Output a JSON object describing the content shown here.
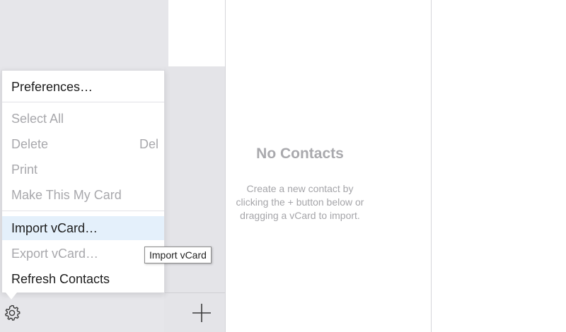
{
  "menu": {
    "items": [
      {
        "label": "Preferences…",
        "enabled": true
      },
      {
        "label": "Select All",
        "enabled": false
      },
      {
        "label": "Delete",
        "shortcut": "Del",
        "enabled": false
      },
      {
        "label": "Print",
        "enabled": false
      },
      {
        "label": "Make This My Card",
        "enabled": false
      },
      {
        "label": "Import vCard…",
        "enabled": true,
        "highlighted": true
      },
      {
        "label": "Export vCard…",
        "enabled": false
      },
      {
        "label": "Refresh Contacts",
        "enabled": true
      }
    ]
  },
  "tooltip": {
    "text": "Import vCard"
  },
  "empty_state": {
    "title": "No Contacts",
    "description_line1": "Create a new contact by",
    "description_line2": "clicking the + button below or",
    "description_line3": "dragging a vCard to import."
  },
  "footer": {
    "gear_icon": "gear-icon",
    "plus_icon": "plus-icon"
  },
  "colors": {
    "sidebar_bg": "#e6e6ea",
    "menu_highlight": "#e4f0fb",
    "disabled_text": "#a8a8ac",
    "empty_text": "#a9a9ad"
  }
}
